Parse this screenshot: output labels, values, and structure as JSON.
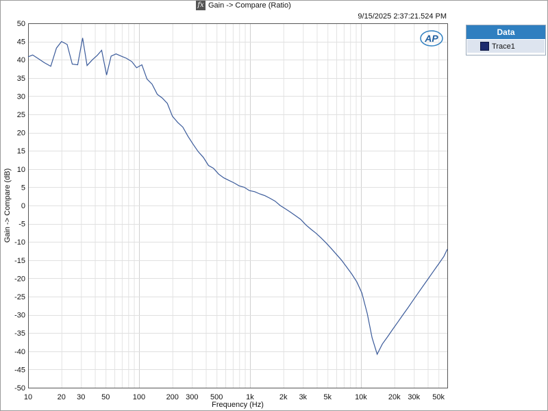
{
  "header": {
    "title": "Gain -> Compare (Ratio)",
    "fx_icon": "fx",
    "timestamp": "9/15/2025 2:37:21.524 PM"
  },
  "logo": {
    "text": "AP"
  },
  "legend": {
    "header": "Data",
    "items": [
      {
        "label": "Trace1",
        "color": "#1c2b6e"
      }
    ]
  },
  "chart_data": {
    "type": "line",
    "title": "Gain -> Compare (Ratio)",
    "xlabel": "Frequency (Hz)",
    "ylabel": "Gain -> Compare (dB)",
    "xscale": "log",
    "xlim": [
      10,
      60000
    ],
    "ylim": [
      -50,
      50
    ],
    "grid": true,
    "legend_position": "right",
    "line_color": "#3a5a9a",
    "x_ticks": [
      {
        "value": 10,
        "label": "10"
      },
      {
        "value": 20,
        "label": "20"
      },
      {
        "value": 30,
        "label": "30"
      },
      {
        "value": 50,
        "label": "50"
      },
      {
        "value": 100,
        "label": "100"
      },
      {
        "value": 200,
        "label": "200"
      },
      {
        "value": 300,
        "label": "300"
      },
      {
        "value": 500,
        "label": "500"
      },
      {
        "value": 1000,
        "label": "1k"
      },
      {
        "value": 2000,
        "label": "2k"
      },
      {
        "value": 3000,
        "label": "3k"
      },
      {
        "value": 5000,
        "label": "5k"
      },
      {
        "value": 10000,
        "label": "10k"
      },
      {
        "value": 20000,
        "label": "20k"
      },
      {
        "value": 30000,
        "label": "30k"
      },
      {
        "value": 50000,
        "label": "50k"
      }
    ],
    "y_ticks": [
      50,
      45,
      40,
      35,
      30,
      25,
      20,
      15,
      10,
      5,
      0,
      -5,
      -10,
      -15,
      -20,
      -25,
      -30,
      -35,
      -40,
      -45,
      -50
    ],
    "series": [
      {
        "name": "Trace1",
        "x": [
          10,
          11,
          12.5,
          14,
          16,
          18,
          20,
          22.5,
          25,
          28,
          31,
          34,
          38,
          42,
          46,
          51,
          56,
          62,
          69,
          77,
          86,
          95,
          106,
          118,
          131,
          146,
          162,
          180,
          200,
          223,
          248,
          276,
          307,
          341,
          380,
          422,
          469,
          522,
          580,
          645,
          718,
          798,
          888,
          987,
          1100,
          1220,
          1360,
          1510,
          1680,
          1870,
          2080,
          2310,
          2570,
          2860,
          3180,
          3540,
          3930,
          4370,
          4860,
          5400,
          6010,
          6680,
          7430,
          8260,
          9190,
          10200,
          11400,
          12600,
          14000,
          15600,
          17400,
          19300,
          21500,
          23900,
          26600,
          29500,
          32800,
          36500,
          40600,
          45100,
          50200,
          55800,
          60000
        ],
        "y": [
          40.8,
          41.3,
          40.2,
          39.2,
          38.2,
          43.2,
          45.0,
          44.2,
          38.8,
          38.6,
          46.0,
          38.4,
          40.0,
          41.2,
          42.6,
          35.8,
          41.0,
          41.6,
          41.0,
          40.4,
          39.5,
          37.8,
          38.6,
          34.7,
          33.3,
          30.5,
          29.5,
          28.0,
          24.5,
          22.8,
          21.5,
          19.0,
          16.8,
          14.8,
          13.2,
          11.0,
          10.2,
          8.6,
          7.6,
          6.9,
          6.2,
          5.4,
          5.0,
          4.1,
          3.8,
          3.2,
          2.7,
          2.0,
          1.2,
          0.0,
          -0.9,
          -1.8,
          -2.8,
          -3.8,
          -5.3,
          -6.5,
          -7.6,
          -8.9,
          -10.3,
          -11.8,
          -13.4,
          -15.0,
          -16.9,
          -18.8,
          -21.0,
          -24.0,
          -29.7,
          -36.3,
          -40.8,
          -38.0,
          -36.0,
          -34.0,
          -32.0,
          -30.0,
          -28.0,
          -26.0,
          -24.0,
          -22.0,
          -20.0,
          -18.0,
          -16.0,
          -14.0,
          -12.0
        ]
      }
    ]
  }
}
